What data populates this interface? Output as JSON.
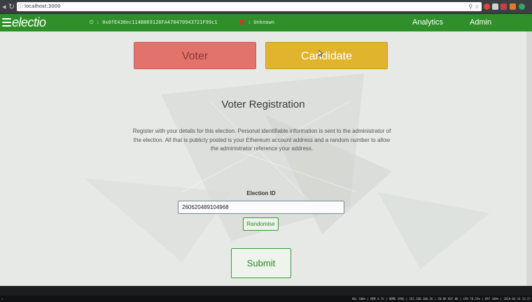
{
  "browser": {
    "url": "localhost:3000",
    "info_icon": "info-icon",
    "search_icon": "zoom-icon",
    "star_icon": "star-icon"
  },
  "navbar": {
    "brand": "electio",
    "account_address": "⏻  : 0x0fE430ec114B869126FA470470943721F99c1",
    "status_label": ": Unknown",
    "links": [
      "Analytics",
      "Admin"
    ],
    "bg_color": "#2f8f2a"
  },
  "roles": {
    "voter_label": "Voter",
    "candidate_label": "Candidate",
    "voter_color": "#e2736c",
    "candidate_color": "#e1b42e"
  },
  "main": {
    "title": "Voter Registration",
    "description": "Register with your details for this election. Personal identifiable information is sent to the administrator of the election. All that is publicly posted is your Ethereum account address and a random number to allow the administrator reference your address.",
    "election_id_label": "Election ID",
    "election_id_value": "260620489104968",
    "randomise_label": "Randomise",
    "submit_label": "Submit"
  },
  "taskbar": {
    "left": "+",
    "status": "VOL 100% | MEM 4.7G | HOME 199G | 192.168.100.58 | IN 0K OUT 0K | CPU 78.53% | BAT 100% | 2018-03-14 22:27"
  }
}
